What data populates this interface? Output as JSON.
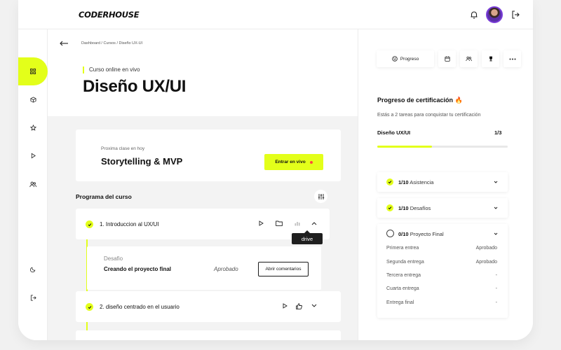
{
  "app": {
    "logo": "CODERHOUSE"
  },
  "topbar": {
    "icons": [
      "bell-icon",
      "avatar",
      "logout-icon"
    ]
  },
  "sidebar": {
    "items": [
      {
        "icon": "grid-icon",
        "active": true
      },
      {
        "icon": "cube-icon",
        "active": false
      },
      {
        "icon": "star-icon",
        "active": false
      },
      {
        "icon": "play-icon",
        "active": false
      },
      {
        "icon": "users-icon",
        "active": false
      }
    ],
    "bottom": [
      {
        "icon": "moon-icon"
      },
      {
        "icon": "logout-icon"
      }
    ]
  },
  "page": {
    "breadcrumb": "Dashboard / Cursos / Diseño UX-UI",
    "course_tag": "Curso online en vivo",
    "title": "Diseño UX/UI"
  },
  "next_class": {
    "label": "Proxima clase en hoy",
    "title": "Storytelling & MVP",
    "button": "Entrar en vivo"
  },
  "program": {
    "title": "Programa del curso",
    "modules": [
      {
        "title": "1. Introduccion al UX/UI",
        "expanded": true
      },
      {
        "title": "2. diseño centrado en el usuario",
        "expanded": false
      }
    ],
    "tooltip": "drive",
    "challenge": {
      "label": "Desafio",
      "title": "Creando el proyecto final",
      "status": "Aprobado",
      "button": "Abrir comentarios"
    }
  },
  "right": {
    "tabs": {
      "progress_label": "Progreso",
      "icons": [
        "smile-icon",
        "calendar-icon",
        "users-icon",
        "trophy-icon",
        "more-icon"
      ]
    },
    "cert": {
      "title": "Progreso de certificación 🔥",
      "subtitle": "Estás a 2 tareas para conquistar tu certificación",
      "course": "Diseño UX/UI",
      "count": "1/3",
      "progress": 0.42
    },
    "sections": [
      {
        "fraction": "1/10",
        "label": "Asistencia",
        "done": true
      },
      {
        "fraction": "1/10",
        "label": "Desafíos",
        "done": true
      },
      {
        "fraction": "0/10",
        "label": "Proyecto Final",
        "done": false
      }
    ],
    "final_rows": [
      {
        "label": "Primera entrea",
        "value": "Aprobado"
      },
      {
        "label": "Segunda entrega",
        "value": "Aprobado"
      },
      {
        "label": "Tercera entrega",
        "value": "-"
      },
      {
        "label": "Cuarta entrega",
        "value": "-"
      },
      {
        "label": "Entrega final",
        "value": "-"
      }
    ]
  },
  "colors": {
    "accent": "#e3ff1a",
    "dark": "#111111",
    "live_dot": "#ff4a3d",
    "tooltip_bg": "#1f1f1f"
  }
}
